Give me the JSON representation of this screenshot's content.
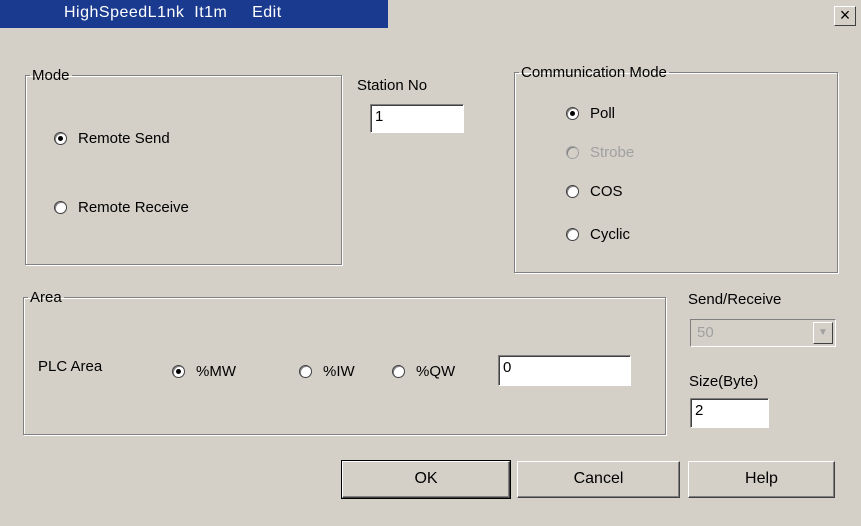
{
  "window": {
    "title": "HighSpeedL1nk  It1m     Edit",
    "close_glyph": "×"
  },
  "mode": {
    "legend": "Mode",
    "options": [
      {
        "label": "Remote Send",
        "checked": true
      },
      {
        "label": "Remote Receive",
        "checked": false
      }
    ]
  },
  "station": {
    "label": "Station No",
    "value": "1"
  },
  "comm_mode": {
    "legend": "Communication Mode",
    "options": [
      {
        "label": "Poll",
        "checked": true,
        "enabled": true
      },
      {
        "label": "Strobe",
        "checked": false,
        "enabled": false
      },
      {
        "label": "COS",
        "checked": false,
        "enabled": true
      },
      {
        "label": "Cyclic",
        "checked": false,
        "enabled": true
      }
    ]
  },
  "area": {
    "legend": "Area",
    "plc_label": "PLC Area",
    "options": [
      {
        "label": "%MW",
        "checked": true
      },
      {
        "label": "%IW",
        "checked": false
      },
      {
        "label": "%QW",
        "checked": false
      }
    ],
    "value": "0"
  },
  "send_receive": {
    "label": "Send/Receive",
    "value": "50"
  },
  "size": {
    "label": "Size(Byte)",
    "value": "2"
  },
  "buttons": {
    "ok": "OK",
    "cancel": "Cancel",
    "help": "Help"
  }
}
